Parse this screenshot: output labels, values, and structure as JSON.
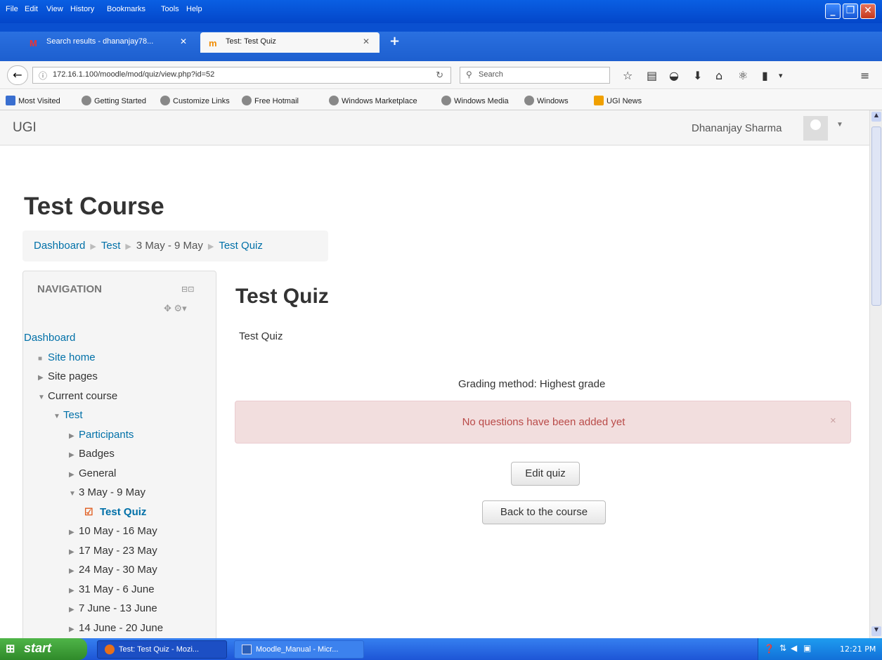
{
  "menu": [
    "File",
    "Edit",
    "View",
    "History",
    "Bookmarks",
    "Tools",
    "Help"
  ],
  "tabs": [
    {
      "title": "Search results - dhananjay78...",
      "icon": "M"
    },
    {
      "title": "Test: Test Quiz",
      "icon": "m"
    }
  ],
  "address": {
    "url": "172.16.1.100/moodle/mod/quiz/view.php?id=52"
  },
  "search": {
    "placeholder": "Search"
  },
  "bookmarks": [
    "Most Visited",
    "Getting Started",
    "Customize Links",
    "Free Hotmail",
    "Windows Marketplace",
    "Windows Media",
    "Windows",
    "UGI News"
  ],
  "site": {
    "brand": "UGI",
    "user": "Dhananjay Sharma"
  },
  "course": {
    "title": "Test Course"
  },
  "breadcrumb": [
    "Dashboard",
    "Test",
    "3 May - 9 May",
    "Test Quiz"
  ],
  "nav": {
    "title": "NAVIGATION",
    "items": [
      "Dashboard",
      "Site home",
      "Site pages",
      "Current course",
      "Test",
      "Participants",
      "Badges",
      "General",
      "3 May - 9 May",
      "Test Quiz",
      "10 May - 16 May",
      "17 May - 23 May",
      "24 May - 30 May",
      "31 May - 6 June",
      "7 June - 13 June",
      "14 June - 20 June"
    ]
  },
  "quiz": {
    "title": "Test Quiz",
    "intro": "Test Quiz",
    "grading": "Grading method: Highest grade",
    "alert": "No questions have been added yet",
    "edit_label": "Edit quiz",
    "back_label": "Back to the course"
  },
  "taskbar": {
    "start": "start",
    "tasks": [
      "Test: Test Quiz - Mozi...",
      "Moodle_Manual - Micr..."
    ],
    "clock": "12:21 PM"
  }
}
